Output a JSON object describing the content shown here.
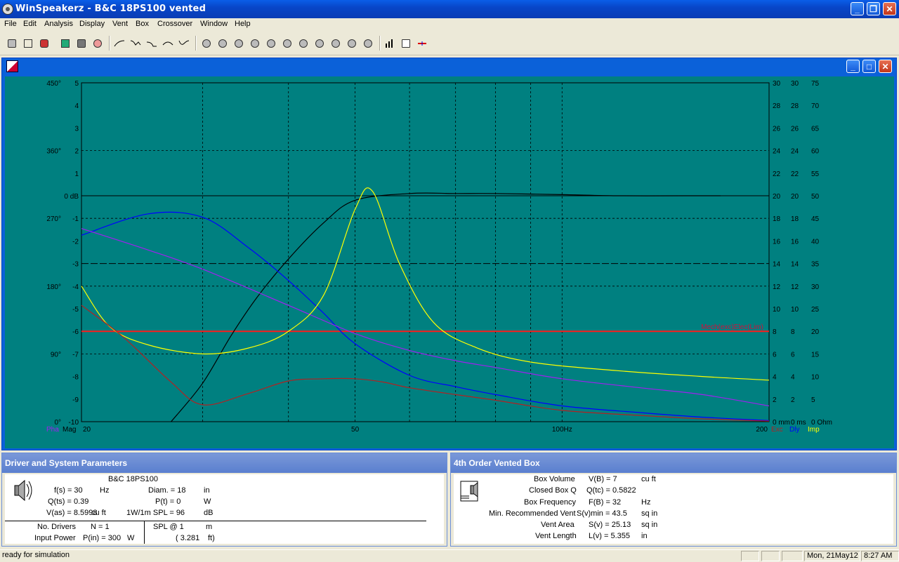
{
  "window": {
    "title": "WinSpeakerz - B&C 18PS100 vented"
  },
  "menu": [
    "File",
    "Edit",
    "Analysis",
    "Display",
    "Vent",
    "Box",
    "Crossover",
    "Window",
    "Help"
  ],
  "chart_data": {
    "type": "line",
    "x_scale": "log",
    "xlim": [
      20,
      200
    ],
    "x_ticks": [
      "20",
      "50",
      "100Hz",
      "200"
    ],
    "left_axis_db": {
      "ticks": [
        "5",
        "4",
        "3",
        "2",
        "1",
        "0 dB",
        "-1",
        "-2",
        "-3",
        "-4",
        "-5",
        "-6",
        "-7",
        "-8",
        "-9",
        "-10"
      ],
      "range": [
        -10,
        5
      ]
    },
    "left_axis_phase": {
      "ticks": [
        "450°",
        "360°",
        "270°",
        "180°",
        "90°",
        "0°"
      ],
      "range": [
        0,
        450
      ]
    },
    "right_axis_exc": {
      "ticks": [
        "30",
        "28",
        "26",
        "24",
        "22",
        "20",
        "18",
        "16",
        "14",
        "12",
        "10",
        "8",
        "6",
        "4",
        "2",
        "0 mm"
      ],
      "range": [
        0,
        30
      ]
    },
    "right_axis_dly": {
      "ticks": [
        "30",
        "28",
        "26",
        "24",
        "22",
        "20",
        "18",
        "16",
        "14",
        "12",
        "10",
        "8",
        "6",
        "4",
        "2",
        "0 ms"
      ],
      "range": [
        0,
        30
      ]
    },
    "right_axis_imp": {
      "ticks": [
        "75",
        "70",
        "65",
        "60",
        "55",
        "50",
        "45",
        "40",
        "35",
        "30",
        "25",
        "20",
        "15",
        "10",
        "5",
        "0 Ohm"
      ],
      "range": [
        0,
        75
      ]
    },
    "axis_labels": {
      "pha": "Pha",
      "mag": "Mag",
      "exc": "Exc",
      "dly": "Dly",
      "imp": "Imp"
    },
    "annotation": "Mech(exc)Elec(Lim)",
    "reference_lines": {
      "zero_db": 0,
      "minus3_db": -3,
      "minus6_db_red": -6
    },
    "series": [
      {
        "axis": "mag",
        "color": "#000000",
        "x": [
          27,
          30,
          33,
          36,
          40,
          45,
          50,
          60,
          70,
          80,
          100,
          120,
          150,
          170
        ],
        "y": [
          -10,
          -8.3,
          -6.2,
          -4.5,
          -2.8,
          -1.2,
          -0.2,
          0.1,
          0.1,
          0.1,
          0.05,
          0,
          0,
          0
        ]
      },
      {
        "axis": "exc",
        "color": "#0000ff",
        "x": [
          20,
          25,
          30,
          35,
          40,
          45,
          50,
          60,
          70,
          80,
          100,
          130,
          160,
          200
        ],
        "y": [
          16.5,
          18.4,
          18.1,
          15.4,
          12.5,
          9.6,
          6.9,
          4.1,
          3.1,
          2.4,
          1.4,
          0.8,
          0.4,
          0.1
        ]
      },
      {
        "axis": "dly",
        "color": "#a020f0",
        "x": [
          20,
          25,
          30,
          40,
          50,
          60,
          70,
          80,
          100,
          130,
          160,
          200
        ],
        "y": [
          17.1,
          15.2,
          13.5,
          10.3,
          7.8,
          6.3,
          5.4,
          4.8,
          3.8,
          3.0,
          2.4,
          1.4
        ]
      },
      {
        "axis": "imp",
        "color": "#ffff00",
        "x": [
          20,
          22,
          25,
          30,
          35,
          40,
          45,
          50,
          53,
          58,
          65,
          75,
          90,
          120,
          160,
          200
        ],
        "y": [
          30,
          21,
          17,
          15,
          16.3,
          20,
          28,
          47,
          51,
          35,
          22,
          16.4,
          13.2,
          11.3,
          10,
          9.2
        ]
      },
      {
        "axis": "dly",
        "color": "#b22222",
        "x": [
          20,
          23,
          27,
          30,
          35,
          40,
          45,
          50,
          55,
          60,
          70,
          80,
          100,
          130,
          160,
          200
        ],
        "y": [
          10.3,
          7.5,
          3.5,
          1.5,
          2.5,
          3.6,
          3.8,
          3.8,
          3.5,
          3.0,
          2.4,
          1.9,
          1.0,
          0.55,
          0.25,
          0.05
        ]
      }
    ]
  },
  "driver_panel": {
    "title": "Driver and System Parameters",
    "driver_name": "B&C 18PS100",
    "fs_label": "f(s) = 30",
    "fs_unit": "Hz",
    "qts_label": "Q(ts) = 0.39",
    "vas_label": "V(as) = 8.5998",
    "vas_unit": "cu ft",
    "diam_label": "Diam. = 18",
    "diam_unit": "in",
    "pt_label": "P(t) = 0",
    "pt_unit": "W",
    "spl_label": "1W/1m SPL = 96",
    "spl_unit": "dB",
    "drivers_label": "No. Drivers",
    "drivers_value": "N = 1",
    "power_label": "Input Power",
    "power_value": "P(in) = 300",
    "power_unit": "W",
    "splat_label": "SPL @ 1",
    "splat_unit": "m",
    "splat_ft": "( 3.281",
    "splat_ft_unit": "ft)"
  },
  "box_panel": {
    "title": "4th Order Vented Box",
    "rows": [
      {
        "label": "Box Volume",
        "value": "V(B) = 7",
        "unit": "cu ft"
      },
      {
        "label": "Closed Box Q",
        "value": "Q(tc) = 0.5822",
        "unit": ""
      },
      {
        "label": "Box Frequency",
        "value": "F(B) = 32",
        "unit": "Hz"
      },
      {
        "label": "Min. Recommended Vent",
        "value": "S(v)min = 43.5",
        "unit": "sq in"
      },
      {
        "label": "Vent Area",
        "value": "S(v) = 25.13",
        "unit": "sq in"
      },
      {
        "label": "Vent Length",
        "value": "L(v) = 5.355",
        "unit": "in"
      }
    ]
  },
  "status": {
    "message": "ready for simulation",
    "date": "Mon, 21May12",
    "time": "8:27 AM"
  }
}
